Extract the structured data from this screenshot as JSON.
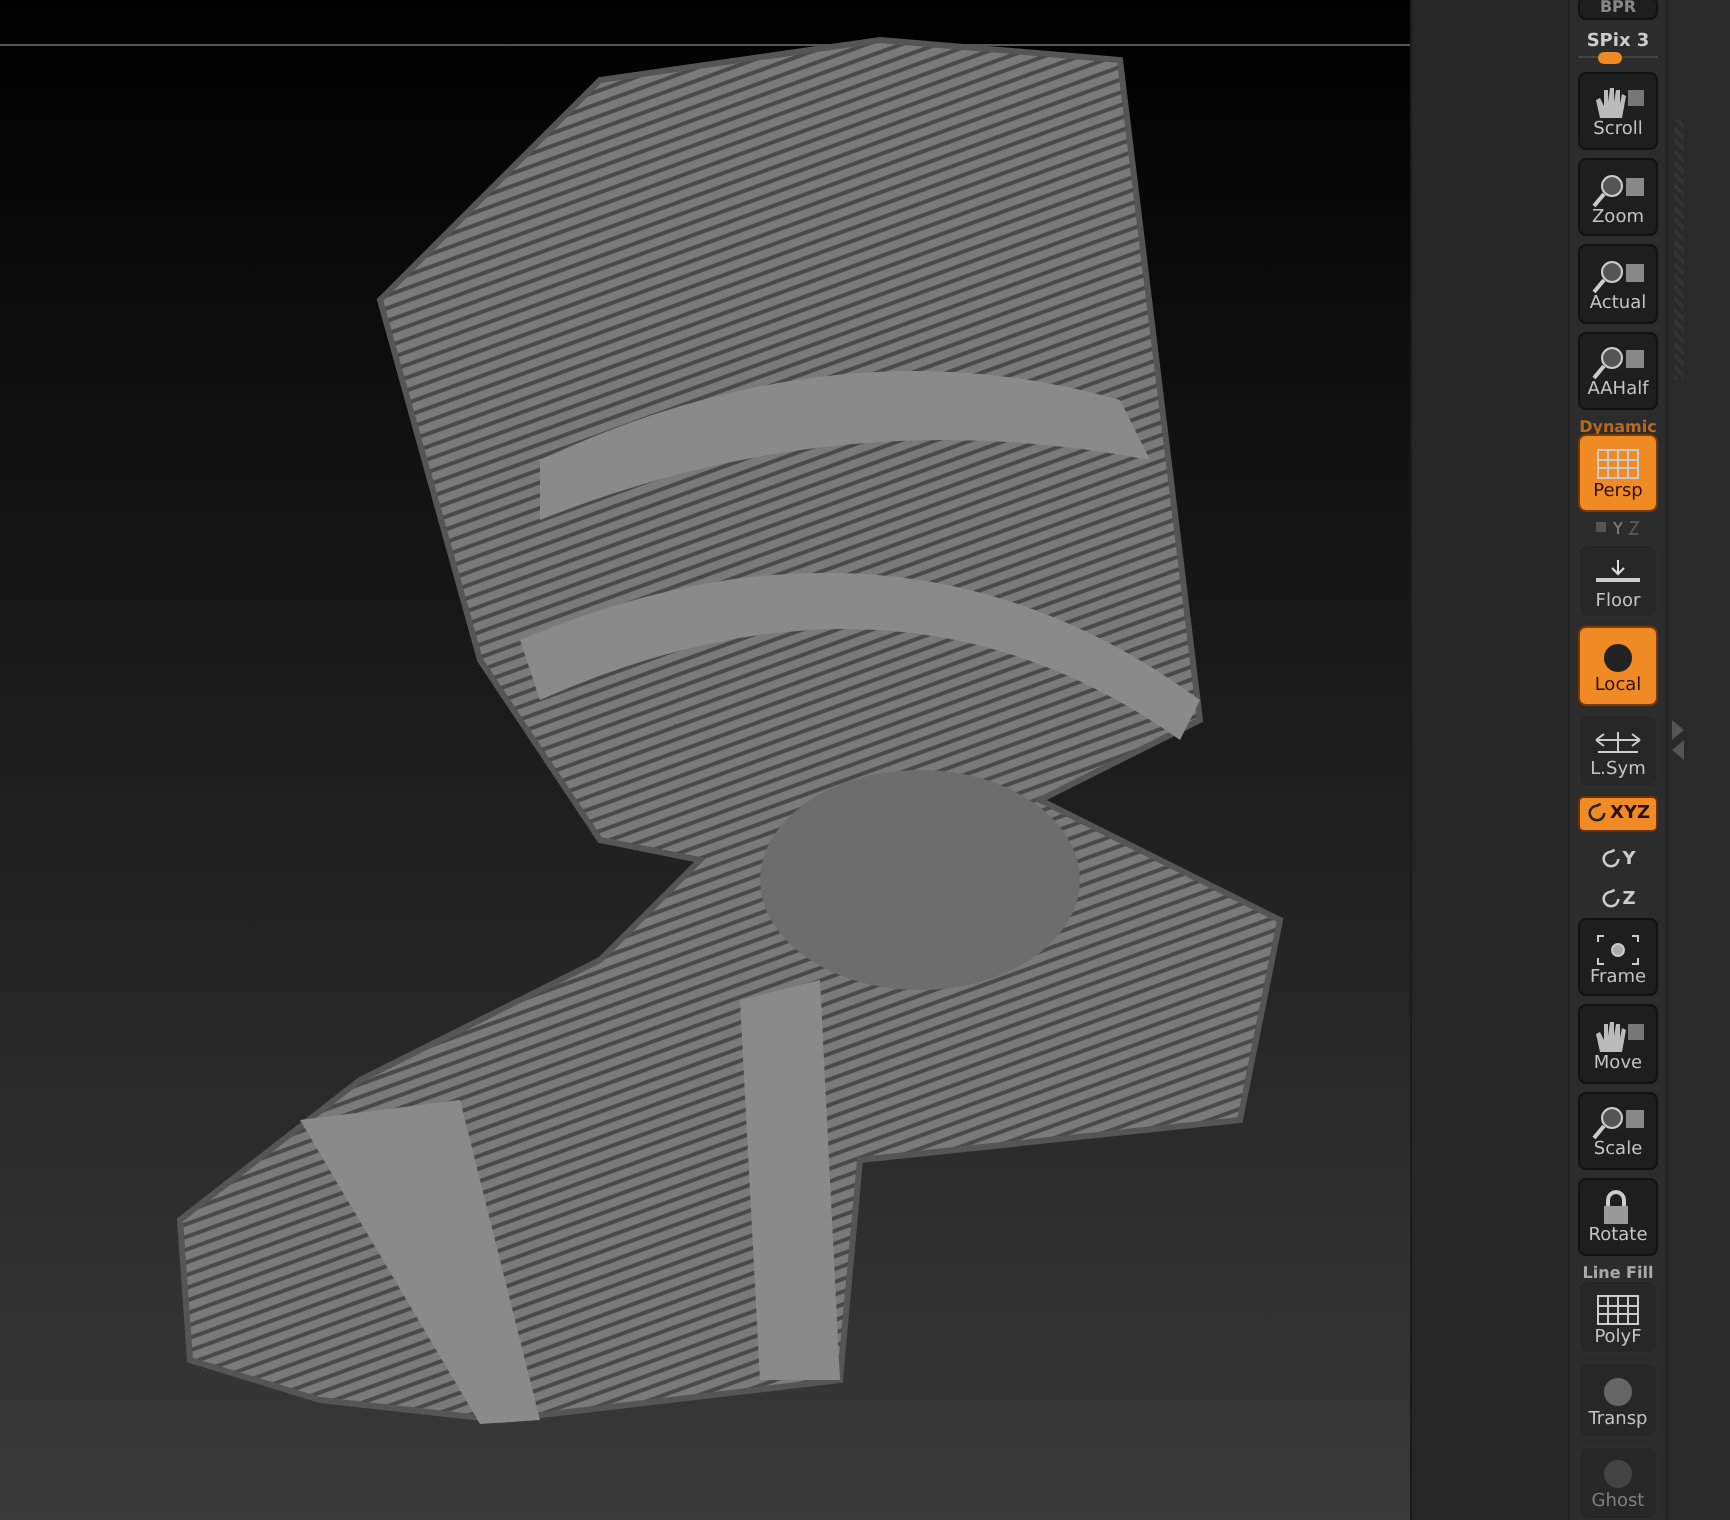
{
  "render_button": {
    "label": "BPR"
  },
  "spix": {
    "label": "SPix 3",
    "level": 0.4
  },
  "tools": [
    {
      "kind": "button",
      "label": "Scroll",
      "active": false,
      "disabled": false
    },
    {
      "kind": "button",
      "label": "Zoom",
      "active": false,
      "disabled": false
    },
    {
      "kind": "button",
      "label": "Actual",
      "active": false,
      "disabled": false
    },
    {
      "kind": "button",
      "label": "AAHalf",
      "active": false,
      "disabled": false
    },
    {
      "kind": "button",
      "label": "Persp",
      "caption": "Dynamic",
      "active": true,
      "disabled": false
    },
    {
      "kind": "flat",
      "label": "Floor",
      "active": false,
      "disabled": false
    },
    {
      "kind": "button",
      "label": "Local",
      "active": true,
      "disabled": false
    },
    {
      "kind": "flat",
      "label": "L.Sym",
      "active": false,
      "disabled": false
    },
    {
      "kind": "toggle",
      "label": "XYZ",
      "active": true,
      "disabled": false
    },
    {
      "kind": "mini",
      "label": "Y",
      "active": false,
      "disabled": false
    },
    {
      "kind": "mini",
      "label": "Z",
      "active": false,
      "disabled": false
    },
    {
      "kind": "button",
      "label": "Frame",
      "active": false,
      "disabled": false
    },
    {
      "kind": "button",
      "label": "Move",
      "active": false,
      "disabled": false
    },
    {
      "kind": "button",
      "label": "Scale",
      "active": false,
      "disabled": false
    },
    {
      "kind": "button",
      "label": "Rotate",
      "active": false,
      "disabled": false
    },
    {
      "kind": "flat",
      "label": "PolyF",
      "caption": "Line Fill",
      "active": false,
      "disabled": false
    },
    {
      "kind": "flat",
      "label": "Transp",
      "active": false,
      "disabled": false
    },
    {
      "kind": "flat",
      "label": "Ghost",
      "active": false,
      "disabled": true
    }
  ]
}
